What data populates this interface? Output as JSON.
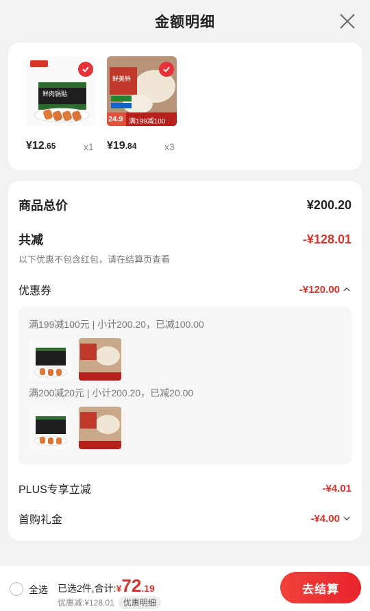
{
  "header": {
    "title": "金额明细"
  },
  "products": [
    {
      "price_int": "¥12",
      "price_dec": ".65",
      "qty": "x1",
      "label": "鲜肉锅贴"
    },
    {
      "price_int": "¥19",
      "price_dec": ".84",
      "qty": "x3",
      "label": "鲜美鲜",
      "tag": "满199减100",
      "tag_price": "24.9"
    }
  ],
  "summary": {
    "total_label": "商品总价",
    "total_value": "¥200.20",
    "discount_label": "共减",
    "discount_value": "-¥128.01",
    "note": "以下优惠不包含红包，请在结算页查看",
    "coupon_label": "优惠券",
    "coupon_value": "-¥120.00",
    "coupon_lines": [
      "满199减100元 | 小计200.20，已减100.00",
      "满200减20元 | 小计200.20，已减20.00"
    ],
    "plus_label": "PLUS专享立减",
    "plus_value": "-¥4.01",
    "first_label": "首购礼金",
    "first_value": "-¥4.00"
  },
  "bottom": {
    "select_all": "全选",
    "selected_text": "已选2件,合计:",
    "currency": "¥",
    "total_int": "72",
    "total_dec": ".19",
    "discount_text": "优惠减:¥128.01",
    "detail_pill": "优惠明细",
    "checkout_label": "去结算"
  },
  "colors": {
    "accent": "#d8352a",
    "button": "#e8323a"
  }
}
